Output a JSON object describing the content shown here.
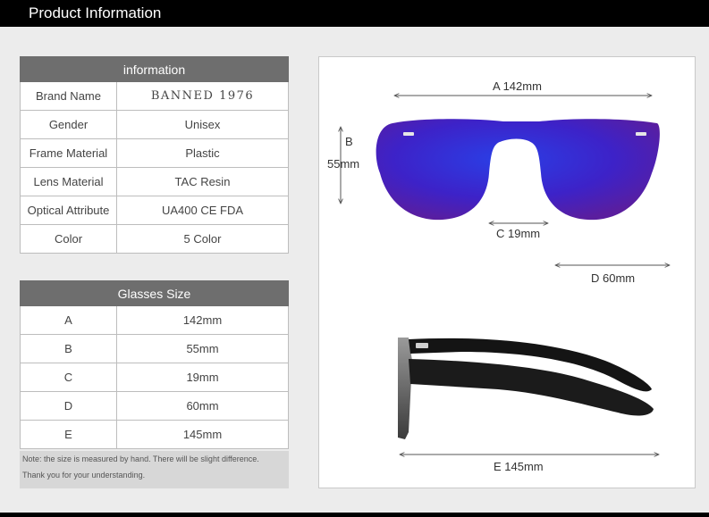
{
  "header": {
    "title": "Product Information"
  },
  "info_table": {
    "title": "information",
    "rows": [
      {
        "label": "Brand Name",
        "value": "BANNED 1976"
      },
      {
        "label": "Gender",
        "value": "Unisex"
      },
      {
        "label": "Frame Material",
        "value": "Plastic"
      },
      {
        "label": "Lens Material",
        "value": "TAC Resin"
      },
      {
        "label": "Optical Attribute",
        "value": "UA400 CE FDA"
      },
      {
        "label": "Color",
        "value": "5 Color"
      }
    ]
  },
  "size_table": {
    "title": "Glasses Size",
    "rows": [
      {
        "label": "A",
        "value": "142mm"
      },
      {
        "label": "B",
        "value": "55mm"
      },
      {
        "label": "C",
        "value": "19mm"
      },
      {
        "label": "D",
        "value": "60mm"
      },
      {
        "label": "E",
        "value": "145mm"
      }
    ]
  },
  "note": {
    "line1": "Note: the size is measured by hand. There will be slight difference.",
    "line2": "Thank you for your understanding."
  },
  "diagram": {
    "label_a": "A 142mm",
    "label_b": "B",
    "label_b_value": "55mm",
    "label_c": "C 19mm",
    "label_d": "D 60mm",
    "label_e": "E 145mm"
  },
  "colors": {
    "header_bg": "#000000",
    "table_header_bg": "#6e6e6e",
    "lens_blue": "#3b2ed6"
  }
}
